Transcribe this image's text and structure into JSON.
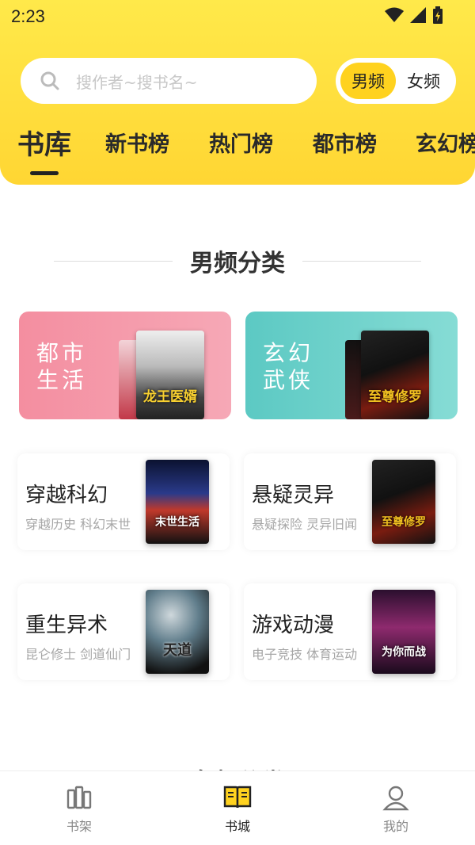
{
  "status": {
    "time": "2:23"
  },
  "search": {
    "placeholder": "搜作者~搜书名~"
  },
  "gender": {
    "male": "男频",
    "female": "女频",
    "selected": "男频"
  },
  "tabs": [
    "书库",
    "新书榜",
    "热门榜",
    "都市榜",
    "玄幻榜"
  ],
  "section": {
    "title": "男频分类",
    "next_title": "女频分类"
  },
  "featured": [
    {
      "label_line1": "都市",
      "label_line2": "生活",
      "cover_title": "龙王医婿"
    },
    {
      "label_line1": "玄幻",
      "label_line2": "武侠",
      "cover_title": "至尊修罗"
    }
  ],
  "categories": [
    {
      "title": "穿越科幻",
      "sub": "穿越历史 科幻末世",
      "cover_title": "末世生活"
    },
    {
      "title": "悬疑灵异",
      "sub": "悬疑探险 灵异旧闻",
      "cover_title": "至尊修罗"
    },
    {
      "title": "重生异术",
      "sub": "昆仑修士 剑道仙门",
      "cover_title": "天道"
    },
    {
      "title": "游戏动漫",
      "sub": "电子竞技 体育运动",
      "cover_title": "为你而战"
    }
  ],
  "bottom_nav": [
    {
      "label": "书架",
      "icon": "bookshelf-icon"
    },
    {
      "label": "书城",
      "icon": "open-book-icon",
      "active": true
    },
    {
      "label": "我的",
      "icon": "user-icon"
    }
  ],
  "colors": {
    "accent": "#ffd21f",
    "header": "#ffe040"
  }
}
